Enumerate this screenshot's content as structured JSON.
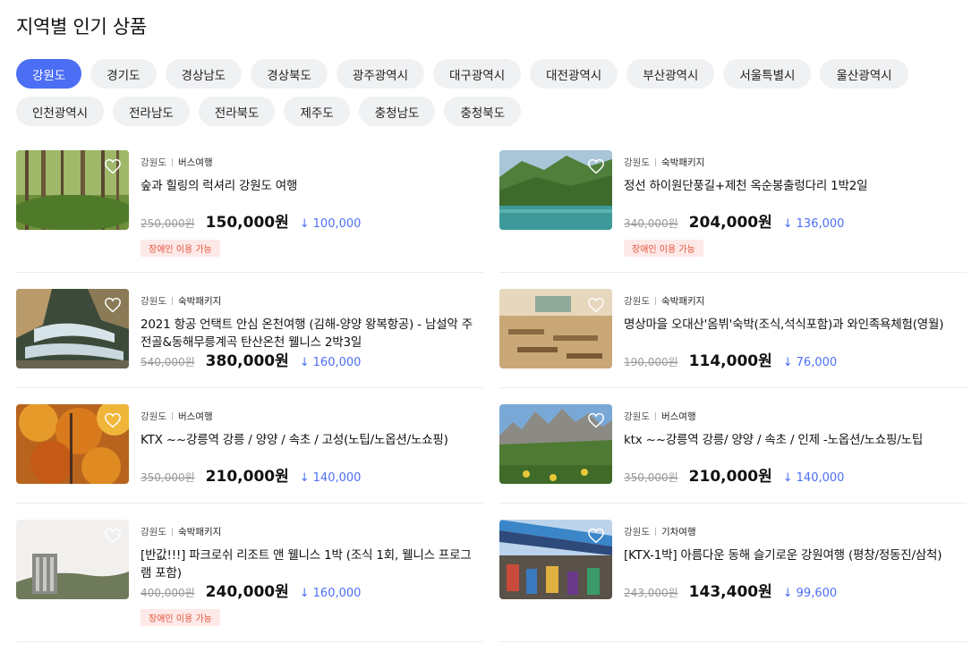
{
  "page": {
    "title": "지역별 인기 상품"
  },
  "regions": [
    {
      "label": "강원도",
      "active": true
    },
    {
      "label": "경기도"
    },
    {
      "label": "경상남도"
    },
    {
      "label": "경상북도"
    },
    {
      "label": "광주광역시"
    },
    {
      "label": "대구광역시"
    },
    {
      "label": "대전광역시"
    },
    {
      "label": "부산광역시"
    },
    {
      "label": "서울특별시"
    },
    {
      "label": "울산광역시"
    },
    {
      "label": "인천광역시"
    },
    {
      "label": "전라남도"
    },
    {
      "label": "전라북도"
    },
    {
      "label": "제주도"
    },
    {
      "label": "충청남도"
    },
    {
      "label": "충청북도"
    }
  ],
  "products": [
    {
      "region": "강원도",
      "category": "버스여행",
      "title": "숲과 힐링의 럭셔리 강원도 여행",
      "original_price": "250,000원",
      "price": "150,000원",
      "discount": "100,000",
      "badge": "장애인 이용 가능",
      "image": "forest"
    },
    {
      "region": "강원도",
      "category": "숙박패키지",
      "title": "정선 하이원단풍길+제천 옥순봉출렁다리 1박2일",
      "original_price": "340,000원",
      "price": "204,000원",
      "discount": "136,000",
      "badge": "장애인 이용 가능",
      "image": "lake"
    },
    {
      "region": "강원도",
      "category": "숙박패키지",
      "title": "2021 항공 언택트 안심 온천여행 (김해-양양 왕복항공) - 남설악 주전골&동해무릉계곡 탄산온천 웰니스 2박3일",
      "original_price": "540,000원",
      "price": "380,000원",
      "discount": "160,000",
      "image": "valley"
    },
    {
      "region": "강원도",
      "category": "숙박패키지",
      "title": "명상마을 오대산'옴뷔'숙박(조식,석식포함)과 와인족욕체험(영월)",
      "original_price": "190,000원",
      "price": "114,000원",
      "discount": "76,000",
      "image": "restaurant"
    },
    {
      "region": "강원도",
      "category": "버스여행",
      "title": "KTX ~~강릉역 강릉 / 양양 / 속초 / 고성(노팁/노옵션/노쇼핑)",
      "original_price": "350,000원",
      "price": "210,000원",
      "discount": "140,000",
      "image": "autumn"
    },
    {
      "region": "강원도",
      "category": "버스여행",
      "title": "ktx ~~강릉역 강릉/ 양양 / 속초 / 인제 -노옵션/노쇼핑/노팁",
      "original_price": "350,000원",
      "price": "210,000원",
      "discount": "140,000",
      "image": "mountain"
    },
    {
      "region": "강원도",
      "category": "숙박패키지",
      "title": "[반값!!!] 파크로쉬 리조트 앤 웰니스 1박 (조식 1회, 웰니스 프로그램 포함)",
      "original_price": "400,000원",
      "price": "240,000원",
      "discount": "160,000",
      "badge": "장애인 이용 가능",
      "image": "resort"
    },
    {
      "region": "강원도",
      "category": "기차여행",
      "title": "[KTX-1박] 아름다운 동해 슬기로운 강원여행 (평창/정동진/삼척)",
      "original_price": "243,000원",
      "price": "143,400원",
      "discount": "99,600",
      "image": "market"
    }
  ],
  "icons": {
    "wishlist": "heart-outline-icon",
    "discount": "arrow-down-icon"
  },
  "colors": {
    "accent": "#4c6ef5",
    "badge_bg": "#fde9e7",
    "badge_text": "#e5533b"
  }
}
